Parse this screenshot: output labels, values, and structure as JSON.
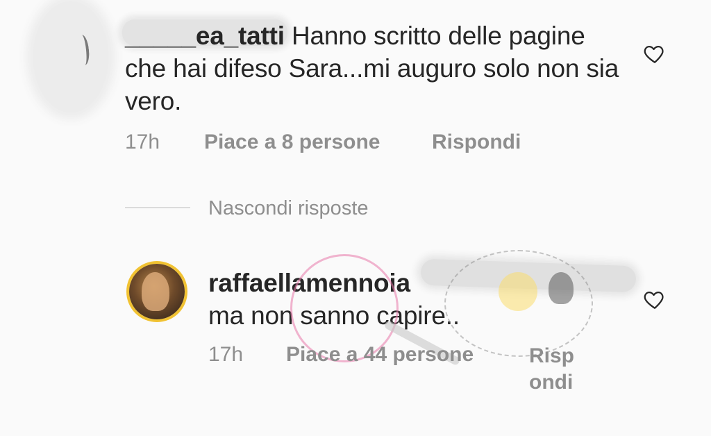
{
  "comment1": {
    "username": "_____ea_tatti",
    "text": "Hanno scritto delle pagine che hai difeso Sara...mi auguro solo non sia vero.",
    "time": "17h",
    "likes": "Piace a 8 persone",
    "reply": "Rispondi"
  },
  "hide_replies": "Nascondi risposte",
  "comment2": {
    "username": "raffaellamennoia",
    "text": "ma non sanno capire..",
    "time": "17h",
    "likes": "Piace a 44 persone",
    "reply_line1": "Risp",
    "reply_line2": "ondi"
  },
  "icons": {
    "like": "heart-outline-icon"
  },
  "colors": {
    "text": "#262626",
    "meta": "#8e8e8e",
    "background": "#fafafa"
  }
}
